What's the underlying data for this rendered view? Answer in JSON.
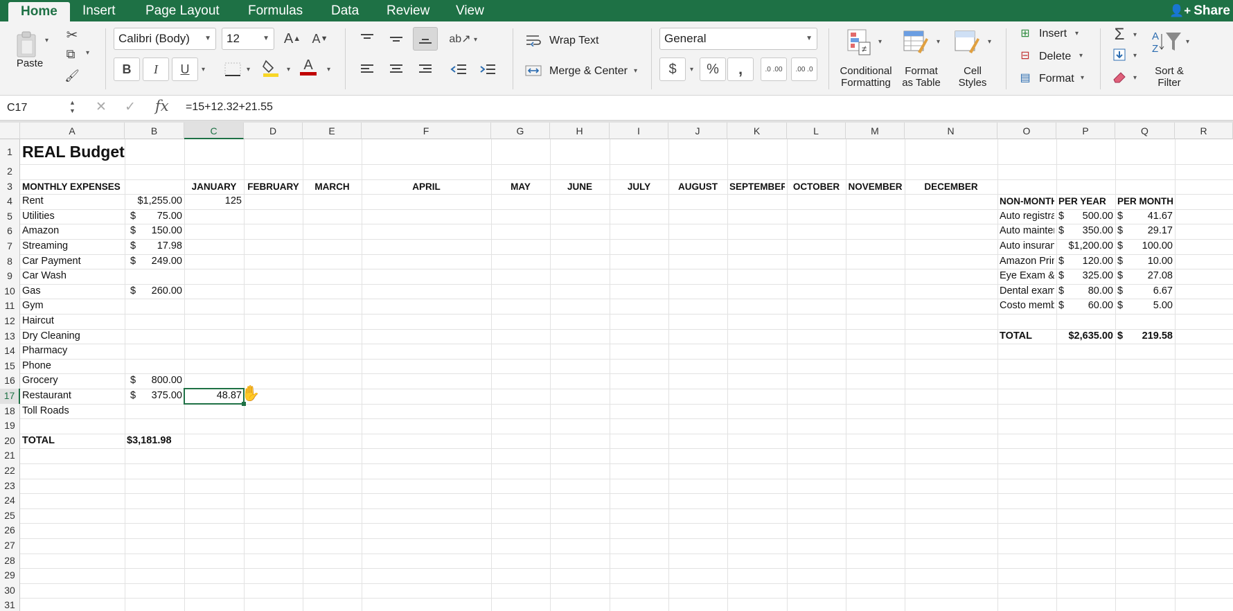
{
  "tabs": [
    "Home",
    "Insert",
    "Page Layout",
    "Formulas",
    "Data",
    "Review",
    "View"
  ],
  "share_label": "Share",
  "ribbon": {
    "paste_label": "Paste",
    "font_name": "Calibri (Body)",
    "font_size": "12",
    "bold": "B",
    "italic": "I",
    "underline": "U",
    "font_color_glyph": "A",
    "wrap_text": "Wrap Text",
    "merge_center": "Merge & Center",
    "number_format": "General",
    "currency": "$",
    "percent": "%",
    "comma": ",",
    "inc_decimal": ".0 .00",
    "dec_decimal": ".00 .0",
    "cond_formatting": [
      "Conditional",
      "Formatting"
    ],
    "format_table": [
      "Format",
      "as Table"
    ],
    "cell_styles": [
      "Cell",
      "Styles"
    ],
    "insert": "Insert",
    "delete": "Delete",
    "format": "Format",
    "sort_filter": [
      "Sort &",
      "Filter"
    ]
  },
  "formula_bar": {
    "name_box": "C17",
    "formula": "=15+12.32+21.55"
  },
  "columns": [
    "A",
    "B",
    "C",
    "D",
    "E",
    "F",
    "G",
    "H",
    "I",
    "J",
    "K",
    "L",
    "M",
    "N",
    "O",
    "P",
    "Q",
    "R"
  ],
  "rows": [
    "1",
    "2",
    "3",
    "4",
    "5",
    "6",
    "7",
    "8",
    "9",
    "10",
    "11",
    "12",
    "13",
    "14",
    "15",
    "16",
    "17",
    "18",
    "19",
    "20",
    "21",
    "22",
    "23",
    "24",
    "25",
    "26",
    "27",
    "28",
    "29",
    "30",
    "31"
  ],
  "sheet": {
    "title": "REAL Budget",
    "header_a3": "MONTHLY EXPENSES",
    "months": [
      "JANUARY",
      "FEBRUARY",
      "MARCH",
      "APRIL",
      "MAY",
      "JUNE",
      "JULY",
      "AUGUST",
      "SEPTEMBER",
      "OCTOBER",
      "NOVEMBER",
      "DECEMBER"
    ],
    "expenses": [
      {
        "label": "Rent",
        "cur": "",
        "amt": "$1,255.00"
      },
      {
        "label": "Utilities",
        "cur": "$",
        "amt": "75.00"
      },
      {
        "label": "Amazon",
        "cur": "$",
        "amt": "150.00"
      },
      {
        "label": "Streaming",
        "cur": "$",
        "amt": "17.98"
      },
      {
        "label": "Car Payment",
        "cur": "$",
        "amt": "249.00"
      },
      {
        "label": "Car Wash",
        "cur": "",
        "amt": ""
      },
      {
        "label": "Gas",
        "cur": "$",
        "amt": "260.00"
      },
      {
        "label": "Gym",
        "cur": "",
        "amt": ""
      },
      {
        "label": "Haircut",
        "cur": "",
        "amt": ""
      },
      {
        "label": "Dry Cleaning",
        "cur": "",
        "amt": ""
      },
      {
        "label": "Pharmacy",
        "cur": "",
        "amt": ""
      },
      {
        "label": "Phone",
        "cur": "",
        "amt": ""
      },
      {
        "label": "Grocery",
        "cur": "$",
        "amt": "800.00"
      },
      {
        "label": "Restaurant",
        "cur": "$",
        "amt": "375.00"
      },
      {
        "label": "Toll Roads",
        "cur": "",
        "amt": ""
      }
    ],
    "c4": "125",
    "c17": "48.87",
    "total_label": "TOTAL",
    "total_value": "$3,181.98",
    "nonmonthly": {
      "headers": [
        "NON-MONTHLY",
        "PER YEAR",
        "PER MONTH"
      ],
      "rows": [
        {
          "label": "Auto registration",
          "ycur": "$",
          "year": "500.00",
          "mcur": "$",
          "month": "41.67"
        },
        {
          "label": "Auto maintenance",
          "ycur": "$",
          "year": "350.00",
          "mcur": "$",
          "month": "29.17"
        },
        {
          "label": "Auto insurance",
          "ycur": "",
          "year": "$1,200.00",
          "mcur": "$",
          "month": "100.00"
        },
        {
          "label": "Amazon Prime",
          "ycur": "$",
          "year": "120.00",
          "mcur": "$",
          "month": "10.00"
        },
        {
          "label": "Eye Exam & Glasses",
          "ycur": "$",
          "year": "325.00",
          "mcur": "$",
          "month": "27.08"
        },
        {
          "label": "Dental exam",
          "ycur": "$",
          "year": "80.00",
          "mcur": "$",
          "month": "6.67"
        },
        {
          "label": "Costo membership",
          "ycur": "$",
          "year": "60.00",
          "mcur": "$",
          "month": "5.00"
        }
      ],
      "total_label": "TOTAL",
      "total_year": "$2,635.00",
      "total_mcur": "$",
      "total_month": "219.58"
    }
  },
  "colors": {
    "accent": "#1e7145",
    "grid": "#e2e2e2"
  }
}
